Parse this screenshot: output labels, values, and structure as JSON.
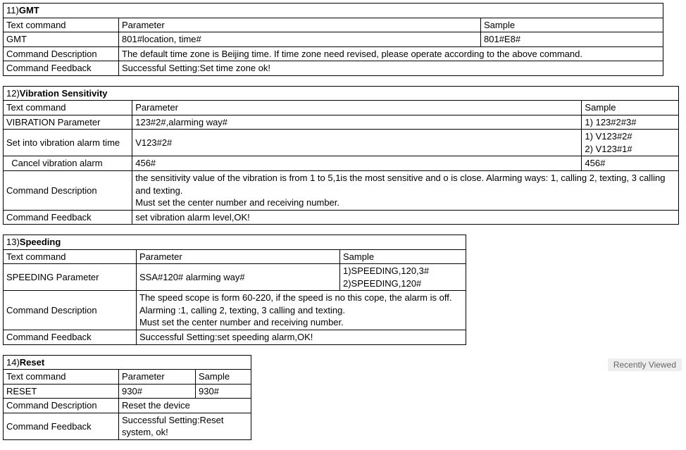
{
  "tables": {
    "gmt": {
      "num": "11)",
      "title": "GMT",
      "h_text": "Text command",
      "h_param": "Parameter",
      "h_sample": "Sample",
      "r1_text": "GMT",
      "r1_param": "801#location, time#",
      "r1_sample": "801#E8#",
      "desc_label": "Command Description",
      "desc": "The default time zone is Beijing time. If time zone need revised, please operate according to the above command.",
      "fb_label": "Command Feedback",
      "fb": "Successful Setting:Set time zone ok!"
    },
    "vib": {
      "num": "12)",
      "title": "Vibration Sensitivity",
      "h_text": "Text command",
      "h_param": "Parameter",
      "h_sample": "Sample",
      "r1_text": "VIBRATION Parameter",
      "r1_param": "123#2#,alarming way#",
      "r1_sample": "1) 123#2#3#",
      "r2_text": "Set into vibration alarm time",
      "r2_param": "V123#2#",
      "r2_sample": "1) V123#2#\n2) V123#1#",
      "r3_text": "  Cancel vibration alarm",
      "r3_param": "456#",
      "r3_sample": "456#",
      "desc_label": "Command Description",
      "desc": "the sensitivity  value of the vibration is from 1 to 5,1is the most sensitive and o is close. Alarming ways: 1, calling 2, texting, 3 calling and texting.\nMust set the center number and receiving number.",
      "fb_label": "Command Feedback",
      "fb": "set vibration alarm level,OK!"
    },
    "spd": {
      "num": "13)",
      "title": "Speeding",
      "h_text": "Text command",
      "h_param": "Parameter",
      "h_sample": "Sample",
      "r1_text": "SPEEDING Parameter",
      "r1_param": "SSA#120# alarming way#",
      "r1_sample": "1)SPEEDING,120,3#\n2)SPEEDING,120#",
      "desc_label": "Command Description",
      "desc": "The speed scope is form 60-220, if the speed is no this cope, the alarm is off.\nAlarming :1, calling 2, texting, 3 calling and texting.\nMust set the center number and receiving number.",
      "fb_label": "Command Feedback",
      "fb": "Successful Setting:set speeding alarm,OK!"
    },
    "rst": {
      "num": "14)",
      "title": "Reset",
      "h_text": "Text command",
      "h_param": "Parameter",
      "h_sample": "Sample",
      "r1_text": "RESET",
      "r1_param": "930#",
      "r1_sample": "930#",
      "desc_label": "Command Description",
      "desc": "Reset the device",
      "fb_label": "Command Feedback",
      "fb": "Successful Setting:Reset system, ok!"
    }
  },
  "recently": "Recently Viewed"
}
